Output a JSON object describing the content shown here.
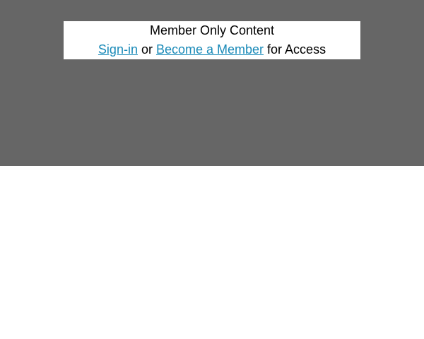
{
  "notice": {
    "title": "Member Only Content",
    "signin_label": "Sign-in",
    "or_text": " or ",
    "become_member_label": "Become a Member",
    "for_access_text": " for Access"
  },
  "colors": {
    "overlay": "#666666",
    "link": "#1a8ab8",
    "text": "#000000",
    "panel": "#ffffff"
  }
}
